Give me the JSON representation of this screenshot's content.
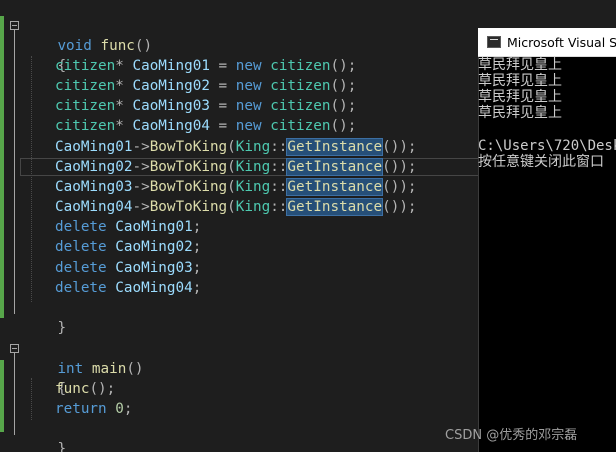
{
  "code": {
    "func_sig": {
      "kw": "void",
      "name": "func",
      "parens": "()"
    },
    "open_brace": "{",
    "close_brace": "}",
    "decls": [
      {
        "type": "citizen",
        "star": "*",
        "var": "CaoMing01",
        "eq": " = ",
        "new": "new",
        "ctor": "citizen",
        "end": "();"
      },
      {
        "type": "citizen",
        "star": "*",
        "var": "CaoMing02",
        "eq": " = ",
        "new": "new",
        "ctor": "citizen",
        "end": "();"
      },
      {
        "type": "citizen",
        "star": "*",
        "var": "CaoMing03",
        "eq": " = ",
        "new": "new",
        "ctor": "citizen",
        "end": "();"
      },
      {
        "type": "citizen",
        "star": "*",
        "var": "CaoMing04",
        "eq": " = ",
        "new": "new",
        "ctor": "citizen",
        "end": "();"
      }
    ],
    "calls": [
      {
        "var": "CaoMing01",
        "arrow": "->",
        "method": "BowToKing",
        "lp": "(",
        "cls": "King",
        "scope": "::",
        "getter": "GetInstance",
        "end": "());"
      },
      {
        "var": "CaoMing02",
        "arrow": "->",
        "method": "BowToKing",
        "lp": "(",
        "cls": "King",
        "scope": "::",
        "getter": "GetInstance",
        "end": "());"
      },
      {
        "var": "CaoMing03",
        "arrow": "->",
        "method": "BowToKing",
        "lp": "(",
        "cls": "King",
        "scope": "::",
        "getter": "GetInstance",
        "end": "());"
      },
      {
        "var": "CaoMing04",
        "arrow": "->",
        "method": "BowToKing",
        "lp": "(",
        "cls": "King",
        "scope": "::",
        "getter": "GetInstance",
        "end": "());"
      }
    ],
    "deletes": [
      {
        "kw": "delete",
        "var": "CaoMing01",
        "end": ";"
      },
      {
        "kw": "delete",
        "var": "CaoMing02",
        "end": ";"
      },
      {
        "kw": "delete",
        "var": "CaoMing03",
        "end": ";"
      },
      {
        "kw": "delete",
        "var": "CaoMing04",
        "end": ";"
      }
    ],
    "main_sig": {
      "kw": "int",
      "name": "main",
      "parens": "()"
    },
    "main_call": {
      "fn": "func",
      "end": "();"
    },
    "main_return": {
      "kw": "return",
      "value": "0",
      "end": ";"
    }
  },
  "console": {
    "title": "Microsoft Visual St",
    "output_lines": [
      "草民拜见皇上",
      "草民拜见皇上",
      "草民拜见皇上",
      "草民拜见皇上"
    ],
    "path_line": "C:\\Users\\720\\Desk",
    "prompt_line": "按任意键关闭此窗口"
  },
  "watermark": "CSDN @优秀的邓宗磊",
  "colors": {
    "editor_bg": "#1e1e1e",
    "keyword": "#569cd6",
    "type": "#4ec9b0",
    "identifier": "#9cdcfe",
    "function": "#dcdcaa",
    "number": "#b5cea8",
    "change_bar": "#57a64a",
    "selection": "#264f78"
  },
  "icons": [
    "fold-minus-icon",
    "console-app-icon"
  ]
}
